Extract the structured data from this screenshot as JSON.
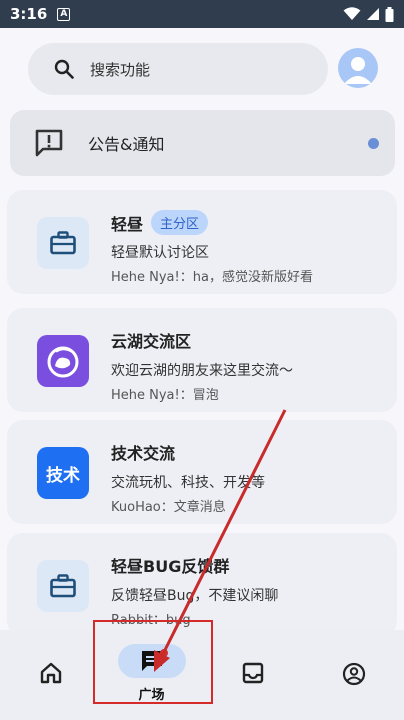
{
  "status_bar": {
    "time": "3:16",
    "notification_icon": "A"
  },
  "search": {
    "label": "搜索功能"
  },
  "notice": {
    "label": "公告&通知"
  },
  "cards": [
    {
      "title": "轻昼",
      "badge": "主分区",
      "description": "轻昼默认讨论区",
      "last_message": "Hehe Nya!：ha，感觉没新版好看",
      "icon": "briefcase-icon"
    },
    {
      "title": "云湖交流区",
      "description": "欢迎云湖的朋友来这里交流～",
      "last_message": "Hehe Nya!：冒泡",
      "icon": "yunhu-logo-icon"
    },
    {
      "title": "技术交流",
      "description": "交流玩机、科技、开发等",
      "last_message": "KuoHao：文章消息",
      "icon": "tech-logo-icon",
      "icon_text": "技术"
    },
    {
      "title": "轻昼BUG反馈群",
      "description": "反馈轻昼Bug，不建议闲聊",
      "last_message": "Rabbit：bug",
      "icon": "briefcase-icon"
    }
  ],
  "bottom_nav": {
    "items": [
      {
        "name": "home",
        "icon": "home-icon"
      },
      {
        "name": "square",
        "icon": "chat-icon",
        "label": "广场",
        "active": true
      },
      {
        "name": "inbox",
        "icon": "inbox-icon"
      },
      {
        "name": "profile",
        "icon": "account-icon"
      }
    ]
  },
  "colors": {
    "status_bar": "#2f3d4e",
    "accent_badge": "#2e63c7",
    "annotation_red": "#d42a2a",
    "yunhu_purple": "#7a4fe0",
    "tech_blue": "#1f6ff2"
  }
}
